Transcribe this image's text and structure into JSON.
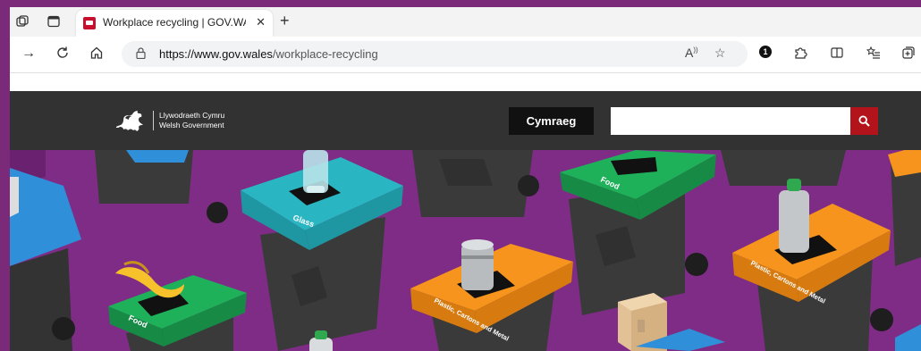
{
  "browser": {
    "tab_title": "Workplace recycling | GOV.WALE",
    "url_host": "https://www.gov.wales",
    "url_path": "/workplace-recycling",
    "extensions_badge": "1"
  },
  "header": {
    "logo_line1": "Llywodraeth Cymru",
    "logo_line2": "Welsh Government",
    "language_button": "Cymraeg",
    "search_placeholder": ""
  },
  "hero": {
    "bin_labels": [
      "Glass",
      "Food",
      "Plastic, Cartons and Metal",
      "Plastic, Cartons and Metal",
      "Food"
    ]
  },
  "colors": {
    "page_bg": "#7a2a78",
    "header_bg": "#323232",
    "search_button": "#b3131b",
    "hero_bg": "#7f2c86",
    "bin_teal": "#29b6c2",
    "bin_green": "#1fb15a",
    "bin_orange": "#f7941d",
    "bin_blue": "#2f8fd8"
  },
  "icons": [
    "workspaces-icon",
    "tab-actions-icon",
    "back-icon",
    "refresh-icon",
    "home-icon",
    "lock-icon",
    "read-aloud-icon",
    "favorite-star-icon",
    "extension-icon",
    "split-screen-icon",
    "favorites-list-icon",
    "collections-icon",
    "search-icon",
    "welsh-dragon-logo-icon"
  ]
}
